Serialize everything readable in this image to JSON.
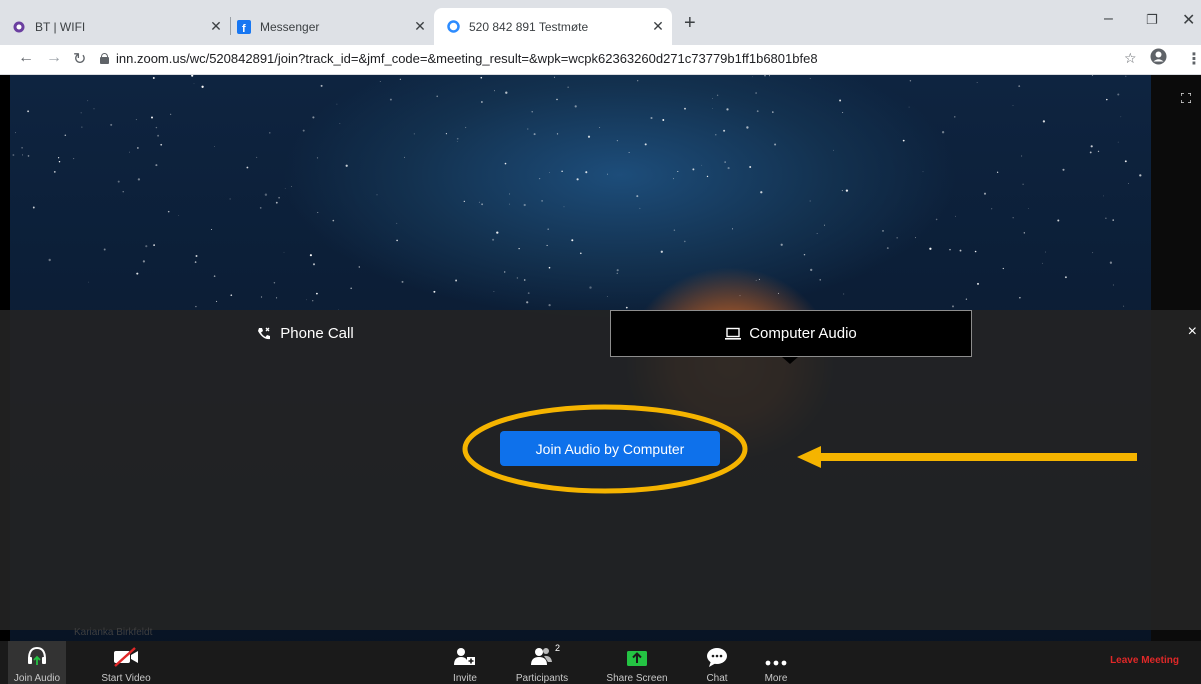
{
  "browser": {
    "tabs": [
      {
        "title": "BT | WIFI",
        "active": false
      },
      {
        "title": "Messenger",
        "active": false
      },
      {
        "title": "520 842 891 Testmøte",
        "active": true
      }
    ],
    "url": "inn.zoom.us/wc/520842891/join?track_id=&jmf_code=&meeting_result=&wpk=wcpk62363260d271c73779b1ff1b6801bfe8"
  },
  "audio_dialog": {
    "tabs": [
      {
        "label": "Phone Call",
        "icon": "phone-icon"
      },
      {
        "label": "Computer Audio",
        "icon": "laptop-icon",
        "selected": true
      }
    ],
    "join_button": "Join Audio by Computer",
    "close": "×"
  },
  "video": {
    "participant_name": "Karianka Birkfeldt"
  },
  "toolbar": {
    "items": [
      {
        "label": "Join Audio",
        "icon": "headphone-icon"
      },
      {
        "label": "Start Video",
        "icon": "video-off-icon"
      },
      {
        "label": "Invite",
        "icon": "invite-icon"
      },
      {
        "label": "Participants",
        "icon": "participants-icon",
        "count": "2"
      },
      {
        "label": "Share Screen",
        "icon": "share-screen-icon"
      },
      {
        "label": "Chat",
        "icon": "chat-icon"
      },
      {
        "label": "More",
        "icon": "more-icon"
      }
    ],
    "leave": "Leave Meeting"
  },
  "colors": {
    "primary_button": "#0e71eb",
    "highlight": "#f5b400",
    "leave": "#e02828",
    "share_screen": "#24c343"
  }
}
